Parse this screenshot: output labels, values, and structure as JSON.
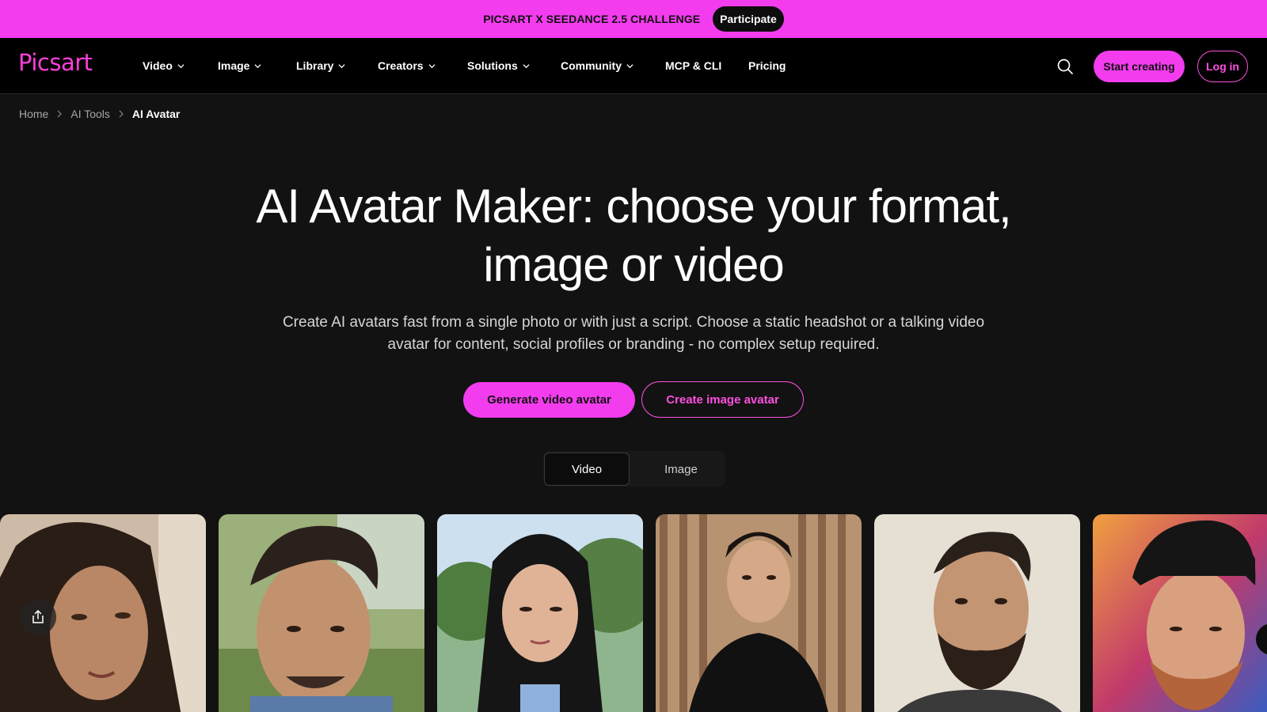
{
  "promo": {
    "text": "PICSART X SEEDANCE 2.5 CHALLENGE",
    "button": "Participate"
  },
  "nav": {
    "logo": "Picsart",
    "items": [
      {
        "label": "Video",
        "dropdown": true
      },
      {
        "label": "Image",
        "dropdown": true
      },
      {
        "label": "Library",
        "dropdown": true
      },
      {
        "label": "Creators",
        "dropdown": true
      },
      {
        "label": "Solutions",
        "dropdown": true
      },
      {
        "label": "Community",
        "dropdown": true
      },
      {
        "label": "MCP & CLI",
        "dropdown": false
      },
      {
        "label": "Pricing",
        "dropdown": false
      }
    ],
    "search_icon": "search-icon",
    "start_button": "Start creating",
    "login_button": "Log in"
  },
  "breadcrumb": [
    "Home",
    "AI Tools",
    "AI Avatar"
  ],
  "hero": {
    "title_line1": "AI Avatar Maker: choose your format,",
    "title_line2": "image or video",
    "subtitle_line1": "Create AI avatars fast from a single photo or with just a script. Choose a static headshot or a talking video",
    "subtitle_line2": "avatar for content, social profiles or branding - no complex setup required.",
    "cta_primary": "Generate video avatar",
    "cta_secondary": "Create image avatar"
  },
  "toggle": {
    "options": [
      "Video",
      "Image"
    ],
    "selected": "Video"
  },
  "cards": [
    {
      "name": "avatar-card-1",
      "icon": "share-icon"
    },
    {
      "name": "avatar-card-2"
    },
    {
      "name": "avatar-card-3"
    },
    {
      "name": "avatar-card-4"
    },
    {
      "name": "avatar-card-5"
    },
    {
      "name": "avatar-card-6"
    }
  ],
  "colors": {
    "brand_pink": "#f23cee",
    "background": "#121212",
    "nav_background": "#000000"
  }
}
